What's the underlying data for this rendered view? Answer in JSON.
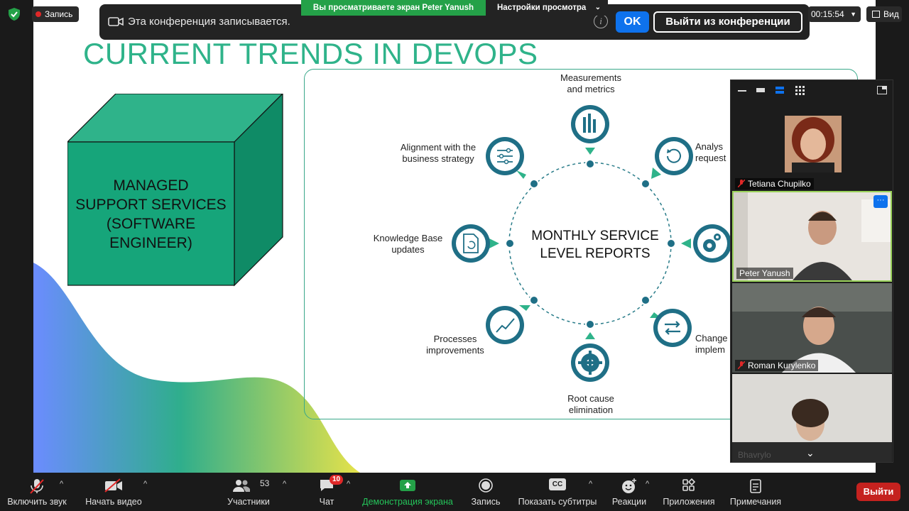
{
  "top": {
    "record_label": "Запись",
    "notice_text": "Эта конференция записывается.",
    "ok_label": "OK",
    "leave_label": "Выйти из конференции",
    "share_banner": "Вы просматриваете экран Peter Yanush",
    "view_settings": "Настройки просмотра",
    "timer": "00:15:54",
    "view_label": "Вид",
    "accent": "#0e72ed",
    "share_color": "#24a148"
  },
  "slide": {
    "title": "CURRENT TRENDS IN DEVOPS",
    "box_text": [
      "MANAGED",
      "SUPPORT SERVICES",
      "(SOFTWARE",
      "ENGINEER)"
    ],
    "center_title": [
      "MONTHLY SERVICE",
      "LEVEL REPORTS"
    ],
    "nodes": {
      "measurements": [
        "Measurements",
        "and metrics"
      ],
      "analysis": [
        "Analys",
        "request"
      ],
      "change": [
        "Change",
        "implem"
      ],
      "root_cause": [
        "Root cause",
        "elimination"
      ],
      "processes": [
        "Processes",
        "improvements"
      ],
      "knowledge": [
        "Knowledge Base",
        "updates"
      ],
      "alignment": [
        "Alignment with the",
        "business strategy"
      ]
    },
    "theme_color": "#1f6f86",
    "green": "#2fb38a"
  },
  "participants": [
    {
      "name": "Tetiana Chupilko",
      "muted": true
    },
    {
      "name": "Peter Yanush",
      "muted": false,
      "active": true
    },
    {
      "name": "Roman Kurylenko",
      "muted": true
    },
    {
      "name": "Bhavrylo",
      "muted": true
    }
  ],
  "toolbar": {
    "unmute": "Включить звук",
    "start_video": "Начать видео",
    "participants": "Участники",
    "participants_count": "53",
    "chat": "Чат",
    "chat_badge": "10",
    "share": "Демонстрация экрана",
    "record": "Запись",
    "captions": "Показать субтитры",
    "captions_icon_text": "CC",
    "reactions": "Реакции",
    "apps": "Приложения",
    "notes": "Примечания",
    "end": "Выйти"
  }
}
